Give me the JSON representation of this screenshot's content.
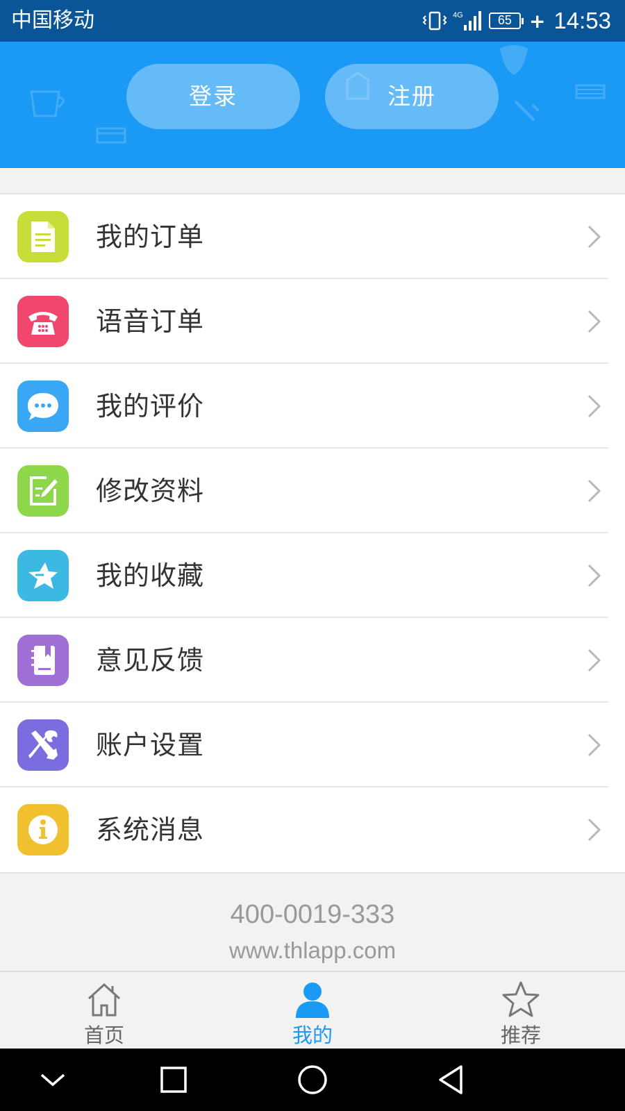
{
  "status_bar": {
    "carrier": "中国移动",
    "network": "4G",
    "battery": "65",
    "time": "14:53"
  },
  "header": {
    "login_label": "登录",
    "register_label": "注册"
  },
  "menu": {
    "items": [
      {
        "label": "我的订单",
        "icon": "document-icon",
        "color": "#c8dc3a"
      },
      {
        "label": "语音订单",
        "icon": "telephone-icon",
        "color": "#f1466e"
      },
      {
        "label": "我的评价",
        "icon": "chat-bubble-icon",
        "color": "#3aa7f4"
      },
      {
        "label": "修改资料",
        "icon": "edit-icon",
        "color": "#8ed64a"
      },
      {
        "label": "我的收藏",
        "icon": "star-icon",
        "color": "#3cb9e2"
      },
      {
        "label": "意见反馈",
        "icon": "notebook-icon",
        "color": "#a06fd6"
      },
      {
        "label": "账户设置",
        "icon": "tools-icon",
        "color": "#7a6de0"
      },
      {
        "label": "系统消息",
        "icon": "info-icon",
        "color": "#f0c02e"
      }
    ]
  },
  "footer": {
    "phone": "400-0019-333",
    "website": "www.thlapp.com"
  },
  "tab_bar": {
    "tabs": [
      {
        "label": "首页",
        "icon": "home-icon"
      },
      {
        "label": "我的",
        "icon": "person-icon",
        "active": true
      },
      {
        "label": "推荐",
        "icon": "star-outline-icon"
      }
    ]
  },
  "colors": {
    "brand": "#1a99f5",
    "status_bar": "#0a5598"
  }
}
